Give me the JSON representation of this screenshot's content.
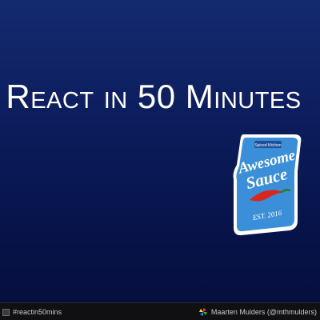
{
  "slide": {
    "title": "React in 50 Minutes"
  },
  "badge": {
    "top_text": "Spiced Kitchen",
    "line1": "Awesome",
    "line2": "Sauce",
    "est": "EST. 2016",
    "colors": {
      "body": "#3b8fd8",
      "outline": "#ffffff",
      "dark": "#1d4f9a",
      "chili": "#d8281e"
    }
  },
  "footer": {
    "hashtag": "#reactin50mins",
    "author": "Maarten Mulders (@mthmulders)",
    "hashtag_icon": "square-icon",
    "author_icon": "pinwheel-icon"
  }
}
